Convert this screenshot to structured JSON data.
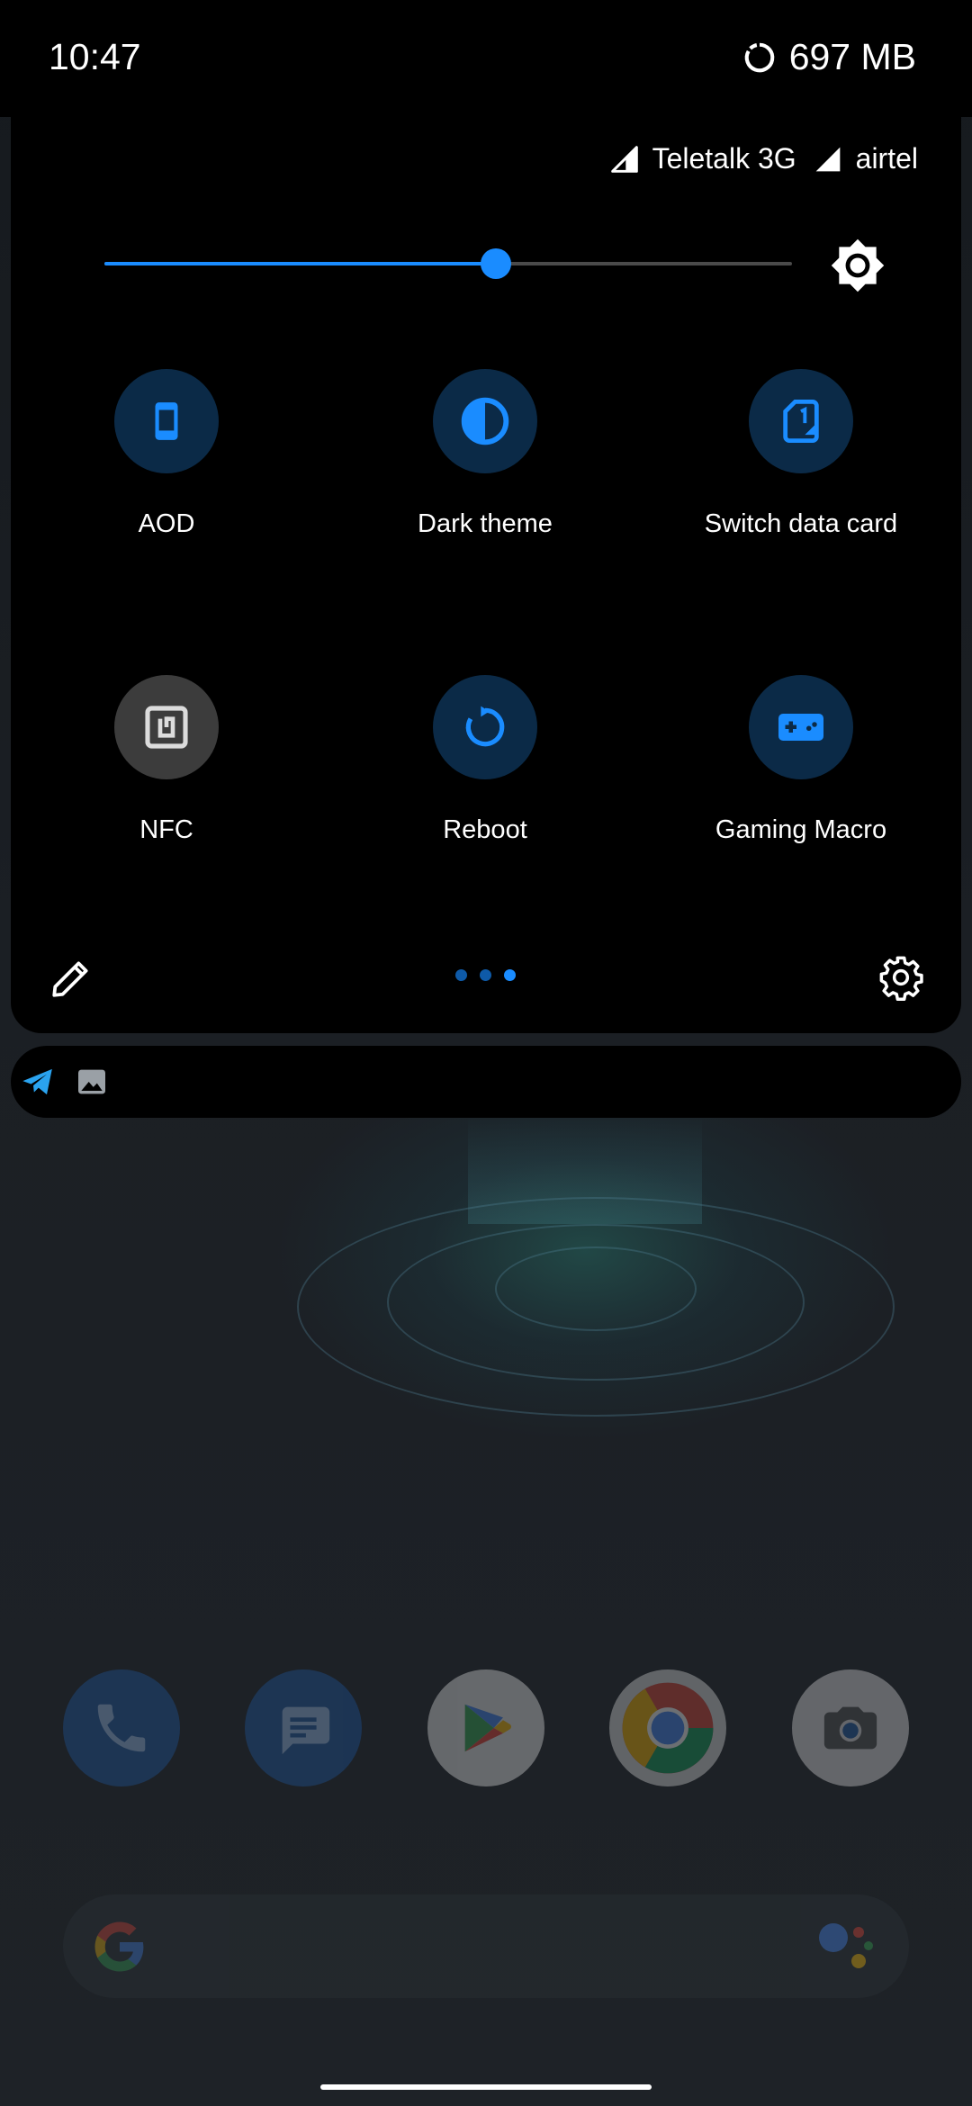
{
  "status_bar": {
    "time": "10:47",
    "data_usage": "697 MB",
    "data_usage_icon": "data-saver-icon"
  },
  "carriers": [
    {
      "name": "Teletalk 3G",
      "icon": "signal-icon"
    },
    {
      "name": "airtel",
      "icon": "signal-icon"
    }
  ],
  "brightness": {
    "level": 0.57,
    "icon": "brightness-icon",
    "accent": "#1a8cff"
  },
  "tiles": [
    {
      "label": "AOD",
      "icon": "phone-screen-icon",
      "state": "on"
    },
    {
      "label": "Dark theme",
      "icon": "half-circle-icon",
      "state": "on"
    },
    {
      "label": "Switch data card",
      "icon": "sim-card-icon",
      "state": "on"
    },
    {
      "label": "NFC",
      "icon": "nfc-icon",
      "state": "off"
    },
    {
      "label": "Reboot",
      "icon": "reboot-icon",
      "state": "on"
    },
    {
      "label": "Gaming Macro",
      "icon": "gamepad-icon",
      "state": "on"
    }
  ],
  "footer": {
    "edit_icon": "pencil-icon",
    "settings_icon": "gear-icon",
    "pages_total": 3,
    "active_page": 3
  },
  "notifications": [
    {
      "icon": "telegram-icon"
    },
    {
      "icon": "image-icon"
    }
  ],
  "dock": [
    {
      "icon": "phone-icon"
    },
    {
      "icon": "messages-icon"
    },
    {
      "icon": "play-store-icon"
    },
    {
      "icon": "chrome-icon"
    },
    {
      "icon": "camera-icon"
    }
  ],
  "colors": {
    "accent": "#1a8cff",
    "tile_on_bg": "#0b2a47",
    "tile_off_bg": "#3c3c3c",
    "panel_bg": "#000000"
  }
}
